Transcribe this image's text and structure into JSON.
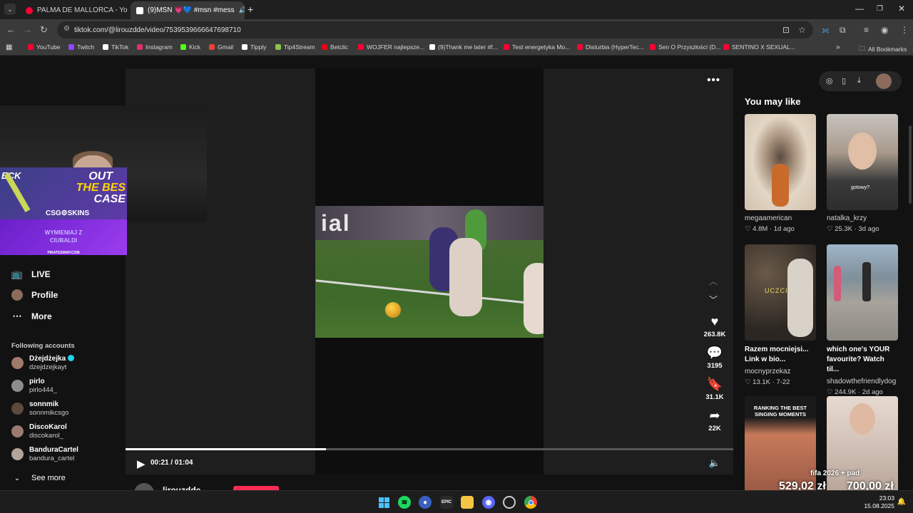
{
  "browser": {
    "tabs": [
      {
        "title": "PALMA DE MALLORCA - Yo",
        "favicon_color": "#ff0033",
        "muted_icon": "speaker-icon"
      },
      {
        "title": "(9)MSN 💗💙 #msn #mess",
        "favicon_color": "#ffffff",
        "muted_icon": "speaker-icon"
      }
    ],
    "url": "tiktok.com/@lirouzdde/video/7539539666647698710",
    "bookmarks": [
      {
        "label": "YouTube",
        "color": "#ff0033"
      },
      {
        "label": "Twitch",
        "color": "#9146ff"
      },
      {
        "label": "TikTok",
        "color": "#ffffff"
      },
      {
        "label": "Instagram",
        "color": "#e1306c"
      },
      {
        "label": "Kick",
        "color": "#53fc18"
      },
      {
        "label": "Gmail",
        "color": "#ea4335"
      },
      {
        "label": "Tipply",
        "color": "#ffffff"
      },
      {
        "label": "Tip4Stream",
        "color": "#8bc34a"
      },
      {
        "label": "Betclic",
        "color": "#e30613"
      },
      {
        "label": "WOJFER najlepsze...",
        "color": "#ff0033"
      },
      {
        "label": "(9)Thank me later #f...",
        "color": "#ffffff"
      },
      {
        "label": "Test energetyka Mo...",
        "color": "#ff0033"
      },
      {
        "label": "Disturbia (HyperTec...",
        "color": "#ff0033"
      },
      {
        "label": "Sen O Przyszłości (D...",
        "color": "#ff0033"
      },
      {
        "label": "SENTINO X SEXUAL...",
        "color": "#ff0033"
      }
    ],
    "all_bookmarks": "All Bookmarks"
  },
  "stream_overlay": {
    "ad_lines": [
      "OUT",
      "THE BES",
      "CASE"
    ],
    "ad_corner": "ECK",
    "ad_brand": "CSG⚙SKINS",
    "ad2_lines": [
      "WYMIENIAJ Z",
      "CIUBALDI"
    ],
    "ad2_footer": "PIRATESWAP.COM",
    "product": "fifa 2026 + pad",
    "prices": [
      "529,02 zł",
      "700,00 zł"
    ]
  },
  "sidebar": {
    "nav": [
      {
        "label": "LIVE",
        "icon": "live-icon"
      },
      {
        "label": "Profile",
        "icon": "avatar-icon"
      },
      {
        "label": "More",
        "icon": "more-icon"
      }
    ],
    "following_header": "Following accounts",
    "accounts": [
      {
        "name": "Dżejdżejka",
        "handle": "dzejdzejkayt",
        "verified": true
      },
      {
        "name": "pirlo",
        "handle": "pirlo444_",
        "verified": false
      },
      {
        "name": "sonnmik",
        "handle": "sonnmikcsgo",
        "verified": false
      },
      {
        "name": "DiscoKarol",
        "handle": "discokarol_",
        "verified": false
      },
      {
        "name": "BanduraCartel",
        "handle": "bandura_cartel",
        "verified": false
      }
    ],
    "see_more": "See more"
  },
  "video": {
    "ad_text": "ial",
    "current_time": "00:21",
    "duration": "01:04",
    "time_display": "00:21 / 01:04",
    "progress": 0.33,
    "actions": [
      {
        "name": "like",
        "icon": "heart-icon",
        "count": "263.8K"
      },
      {
        "name": "comment",
        "icon": "comment-icon",
        "count": "3195"
      },
      {
        "name": "save",
        "icon": "bookmark-icon",
        "count": "31.1K"
      },
      {
        "name": "share",
        "icon": "share-icon",
        "count": "22K"
      }
    ],
    "author": "lirouzdde"
  },
  "recommendations": {
    "header": "You may like",
    "items": [
      {
        "caption": "",
        "user": "megaamerican",
        "likes": "4.8M",
        "age": "1d ago",
        "bg": "#d9cbb7"
      },
      {
        "caption": "",
        "user": "natalka_krzy",
        "likes": "25.3K",
        "age": "3d ago",
        "bg": "#b7a89c",
        "overlay": "gotowy?"
      },
      {
        "caption": "Razem mocniejsi... Link w bio...",
        "user": "mocnyprzekaz",
        "likes": "13.1K",
        "age": "7-22",
        "bg": "#3b3630",
        "overlay": "UCZCIWA"
      },
      {
        "caption": "which one's YOUR favourite? Watch til...",
        "user": "shadowthefriendlydog",
        "likes": "244.9K",
        "age": "2d ago",
        "bg": "#7f8f9b"
      },
      {
        "caption": "",
        "user": "",
        "likes": "",
        "age": "",
        "bg": "#c77a5a",
        "overlay": "RANKING THE BEST SINGING MOMENTS"
      },
      {
        "caption": "",
        "user": "",
        "likes": "",
        "age": "",
        "bg": "#d7c7bc"
      }
    ]
  },
  "taskbar": {
    "time": "23:03",
    "date": "15.08.2025"
  }
}
